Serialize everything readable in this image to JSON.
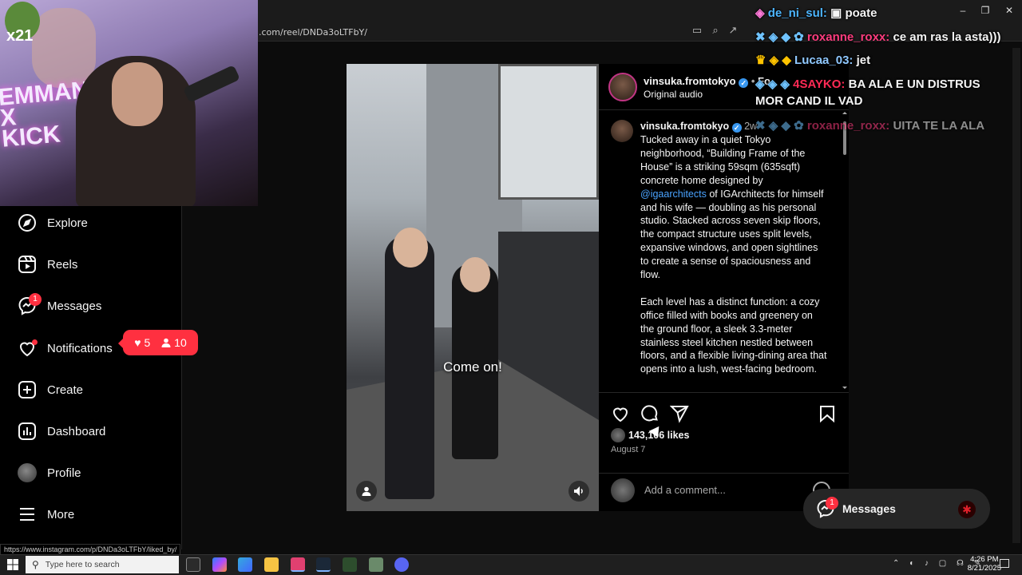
{
  "browser": {
    "url": ".com/reel/DNDa3oLTFbY/",
    "status_url": "https://www.instagram.com/p/DNDa3oLTFbY/liked_by/"
  },
  "webcam": {
    "logo_text": "x21",
    "neon_text": "EMMAN\nX\nKICK"
  },
  "sidebar": {
    "items": [
      {
        "label": "Explore",
        "icon": "compass-icon"
      },
      {
        "label": "Reels",
        "icon": "reels-icon"
      },
      {
        "label": "Messages",
        "icon": "messenger-icon",
        "badge": "1"
      },
      {
        "label": "Notifications",
        "icon": "heart-icon"
      },
      {
        "label": "Create",
        "icon": "plus-square-icon"
      },
      {
        "label": "Dashboard",
        "icon": "dashboard-icon"
      },
      {
        "label": "Profile",
        "icon": "avatar"
      },
      {
        "label": "More",
        "icon": "hamburger-icon"
      }
    ],
    "notif_popup": {
      "likes": "5",
      "follows": "10"
    }
  },
  "post": {
    "username": "vinsuka.fromtokyo",
    "follow_dot": "•",
    "follow_label": "Fo",
    "audio": "Original audio",
    "video_caption": "Come on!",
    "comment": {
      "username": "vinsuka.fromtokyo",
      "time": "2w",
      "para1_before": "Tucked away in a quiet Tokyo neighborhood, “Building Frame of the House” is a striking 59sqm (635sqft) concrete home designed by ",
      "mention": "@igaarchitects",
      "para1_after": " of IGArchitects for himself and his wife — doubling as his personal studio. Stacked across seven skip floors, the compact structure uses split levels, expansive windows, and open sightlines to create a sense of spaciousness and flow.",
      "para2": "Each level has a distinct function: a cozy office filled with books and greenery on the ground floor, a sleek 3.3-meter stainless steel kitchen nestled between floors, and a flexible living-dining area that opens into a lush, west-facing bedroom. Clever design details — like a"
    },
    "likes": "143,106 likes",
    "date": "August 7",
    "comment_placeholder": "Add a comment..."
  },
  "chat": [
    {
      "user": "de_ni_sul:",
      "msg": "poate",
      "color": "#4db6ff"
    },
    {
      "user": "roxanne_roxx:",
      "msg": "ce am ras la asta)))",
      "color": "#ff3d7f"
    },
    {
      "user": "Lucaa_03:",
      "msg": "jet",
      "color": "#8fc8ff"
    },
    {
      "user": "4SAYKO:",
      "msg": "BA ALA E UN DISTRUS",
      "color": "#ff2a55"
    },
    {
      "user": "",
      "msg": "MOR CAND IL VAD",
      "color": "#ffffff"
    },
    {
      "user": "roxanne_roxx:",
      "msg": "UITA TE LA ALA",
      "color": "#ff3d7f"
    }
  ],
  "messages_pill": {
    "label": "Messages",
    "badge": "1"
  },
  "taskbar": {
    "search_placeholder": "Type here to search",
    "time": "4:26 PM",
    "date": "8/21/2025"
  }
}
